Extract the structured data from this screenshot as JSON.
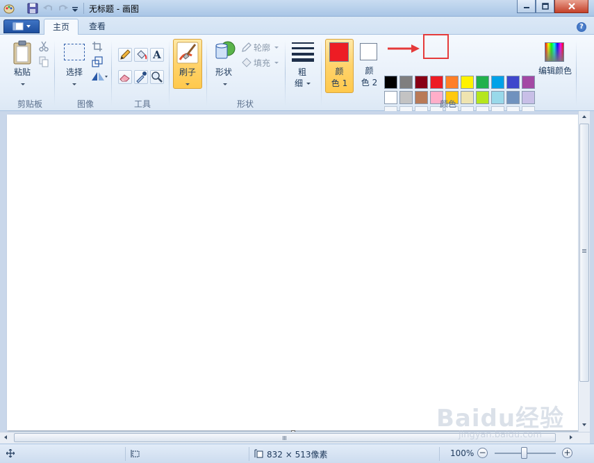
{
  "window": {
    "title": "无标题 - 画图",
    "minimize": "minimize",
    "maximize": "maximize",
    "close": "close"
  },
  "tabs": [
    {
      "label": "主页",
      "active": true
    },
    {
      "label": "查看",
      "active": false
    }
  ],
  "help": "?",
  "ribbon": {
    "clipboard": {
      "group": "剪贴板",
      "paste": "粘贴"
    },
    "image": {
      "group": "图像",
      "select": "选择"
    },
    "tools": {
      "group": "工具",
      "text_tool": "A"
    },
    "brushes": {
      "label": "刷子"
    },
    "shapes": {
      "group": "形状",
      "shapes": "形状",
      "outline": "轮廓",
      "fill": "填充"
    },
    "size": {
      "label_line1": "粗",
      "label_line2": "细"
    },
    "colors": {
      "group": "颜色",
      "color1_line1": "颜",
      "color1_line2": "色 1",
      "color1_value": "#ed1c24",
      "color2_line1": "颜",
      "color2_line2": "色 2",
      "color2_value": "#ffffff",
      "edit_colors": "编辑颜色",
      "palette_row1": [
        "#000000",
        "#7f7f7f",
        "#880015",
        "#ed1c24",
        "#ff7f27",
        "#fff200",
        "#22b14c",
        "#00a2e8",
        "#3f48cc",
        "#a349a4"
      ],
      "palette_row2": [
        "#ffffff",
        "#c3c3c3",
        "#b97a57",
        "#ffaec9",
        "#ffc90e",
        "#efe4b0",
        "#b5e61d",
        "#99d9ea",
        "#7092be",
        "#c8bfe7"
      ],
      "highlight_color": "#e53a3a"
    }
  },
  "status": {
    "canvas_size": "832 × 513像素",
    "zoom": "100%",
    "zoom_minus": "−",
    "zoom_plus": "+"
  },
  "watermark": {
    "main": "Baidu经验",
    "sub": "jingyan.baidu.com"
  }
}
